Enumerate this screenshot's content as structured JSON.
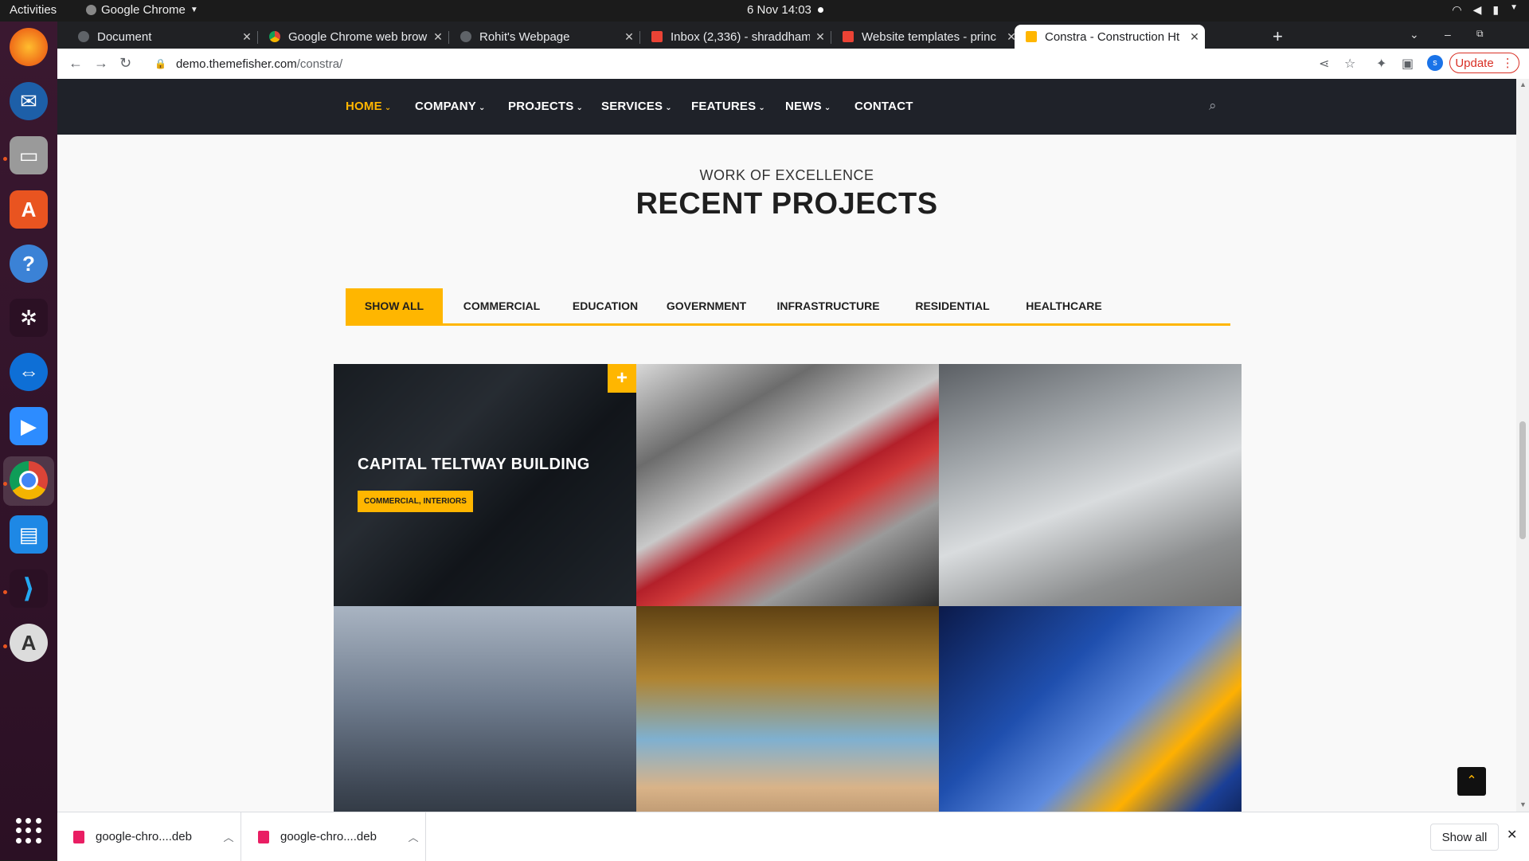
{
  "system": {
    "activities": "Activities",
    "app_name": "Google Chrome",
    "datetime": "6 Nov  14:03"
  },
  "tabs": [
    {
      "title": "Document",
      "active": false
    },
    {
      "title": "Google Chrome web brow",
      "active": false
    },
    {
      "title": "Rohit's Webpage",
      "active": false
    },
    {
      "title": "Inbox (2,336) - shraddham",
      "active": false
    },
    {
      "title": "Website templates - princ",
      "active": false
    },
    {
      "title": "Constra - Construction Ht",
      "active": true
    }
  ],
  "toolbar": {
    "url_host": "demo.themefisher.com",
    "url_path": "/constra/",
    "profile_initial": "s",
    "update_label": "Update"
  },
  "site": {
    "nav": [
      "HOME",
      "COMPANY",
      "PROJECTS",
      "SERVICES",
      "FEATURES",
      "NEWS",
      "CONTACT"
    ],
    "subtitle": "WORK OF EXCELLENCE",
    "title": "RECENT PROJECTS",
    "filters": [
      "SHOW ALL",
      "COMMERCIAL",
      "EDUCATION",
      "GOVERNMENT",
      "INFRASTRUCTURE",
      "RESIDENTIAL",
      "HEALTHCARE"
    ],
    "projects": [
      {
        "title": "CAPITAL TELTWAY BUILDING",
        "tag": "COMMERCIAL, INTERIORS"
      }
    ]
  },
  "downloads": {
    "items": [
      {
        "name": "google-chro....deb"
      },
      {
        "name": "google-chro....deb"
      }
    ],
    "show_all": "Show all"
  },
  "colors": {
    "accent": "#ffb600",
    "nav_bg": "#1f2229",
    "chrome_dark": "#202124",
    "update_red": "#d93025"
  }
}
